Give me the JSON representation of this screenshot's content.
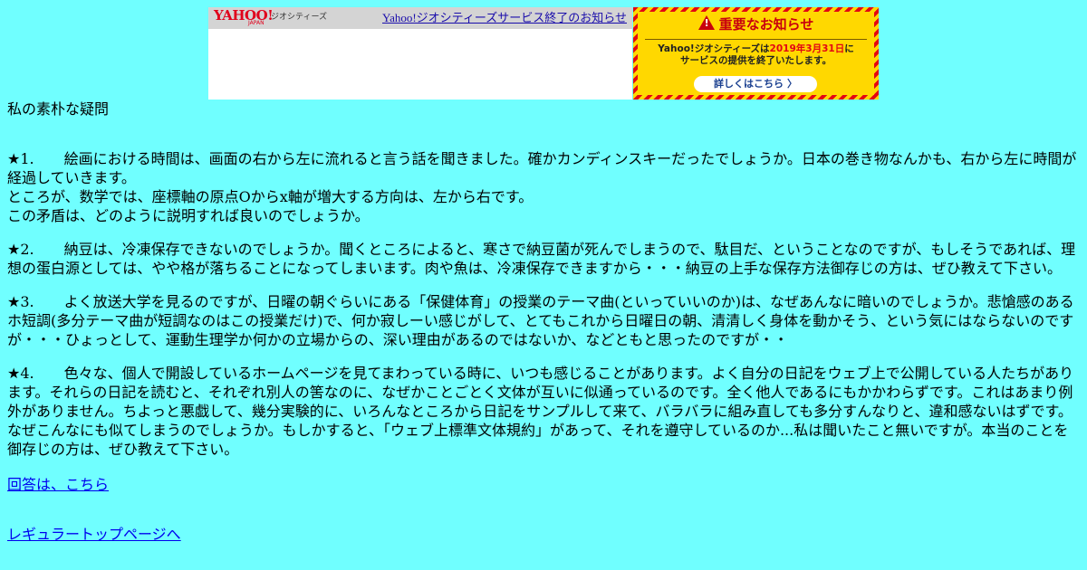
{
  "banner": {
    "logo_text": "YAHOO!",
    "logo_sub": "JAPAN",
    "logo_service": "ジオシティーズ",
    "end_link": "Yahoo!ジオシティーズサービス終了のお知らせ",
    "notice": {
      "title": "重要なお知らせ",
      "line1_a": "Yahoo!ジオシティーズは",
      "line1_date": "2019年3月31日",
      "line1_b": "に",
      "line2": "サービスの提供を終了いたします。",
      "button": "詳しくはこちら",
      "accent_color": "#e30613",
      "bg_color": "#ffd800"
    }
  },
  "page": {
    "title": "私の素朴な疑問",
    "background": "#70ffff"
  },
  "questions": [
    {
      "num": "★1.",
      "lines": [
        "絵画における時間は、画面の右から左に流れると言う話を聞きました。確かカンディンスキーだったでしょうか。日本の巻き物なんかも、右から左に時間が経過していきます。",
        "ところが、数学では、座標軸の原点Oからx軸が増大する方向は、左から右です。",
        "この矛盾は、どのように説明すれば良いのでしょうか。"
      ]
    },
    {
      "num": "★2.",
      "lines": [
        "納豆は、冷凍保存できないのでしょうか。聞くところによると、寒さで納豆菌が死んでしまうので、駄目だ、ということなのですが、もしそうであれば、理想の蛋白源としては、やや格が落ちることになってしまいます。肉や魚は、冷凍保存できますから・・・納豆の上手な保存方法御存じの方は、ぜひ教えて下さい。"
      ]
    },
    {
      "num": "★3.",
      "lines": [
        "よく放送大学を見るのですが、日曜の朝ぐらいにある「保健体育」の授業のテーマ曲(といっていいのか)は、なぜあんなに暗いのでしょうか。悲愴感のあるホ短調(多分テーマ曲が短調なのはこの授業だけ)で、何か寂しーい感じがして、とてもこれから日曜日の朝、清清しく身体を動かそう、という気にはならないのですが・・・ひょっとして、運動生理学か何かの立場からの、深い理由があるのではないか、などともと思ったのですが・・"
      ]
    },
    {
      "num": "★4.",
      "lines": [
        "色々な、個人で開設しているホームページを見てまわっている時に、いつも感じることがあります。よく自分の日記をウェブ上で公開している人たちがあります。それらの日記を読むと、それぞれ別人の筈なのに、なぜかことごとく文体が互いに似通っているのです。全く他人であるにもかかわらずです。これはあまり例外がありません。ちよっと悪戯して、幾分実験的に、いろんなところから日記をサンプルして来て、バラバラに組み直しても多分すんなりと、違和感ないはずです。なぜこんなにも似てしまうのでしょうか。もしかすると、「ウェブ上標準文体規約」があって、それを遵守しているのか...私は聞いたこと無いですが。本当のことを御存じの方は、ぜひ教えて下さい。"
      ]
    }
  ],
  "links": {
    "answer": "回答は、こちら",
    "top": "レギュラートップページへ"
  }
}
